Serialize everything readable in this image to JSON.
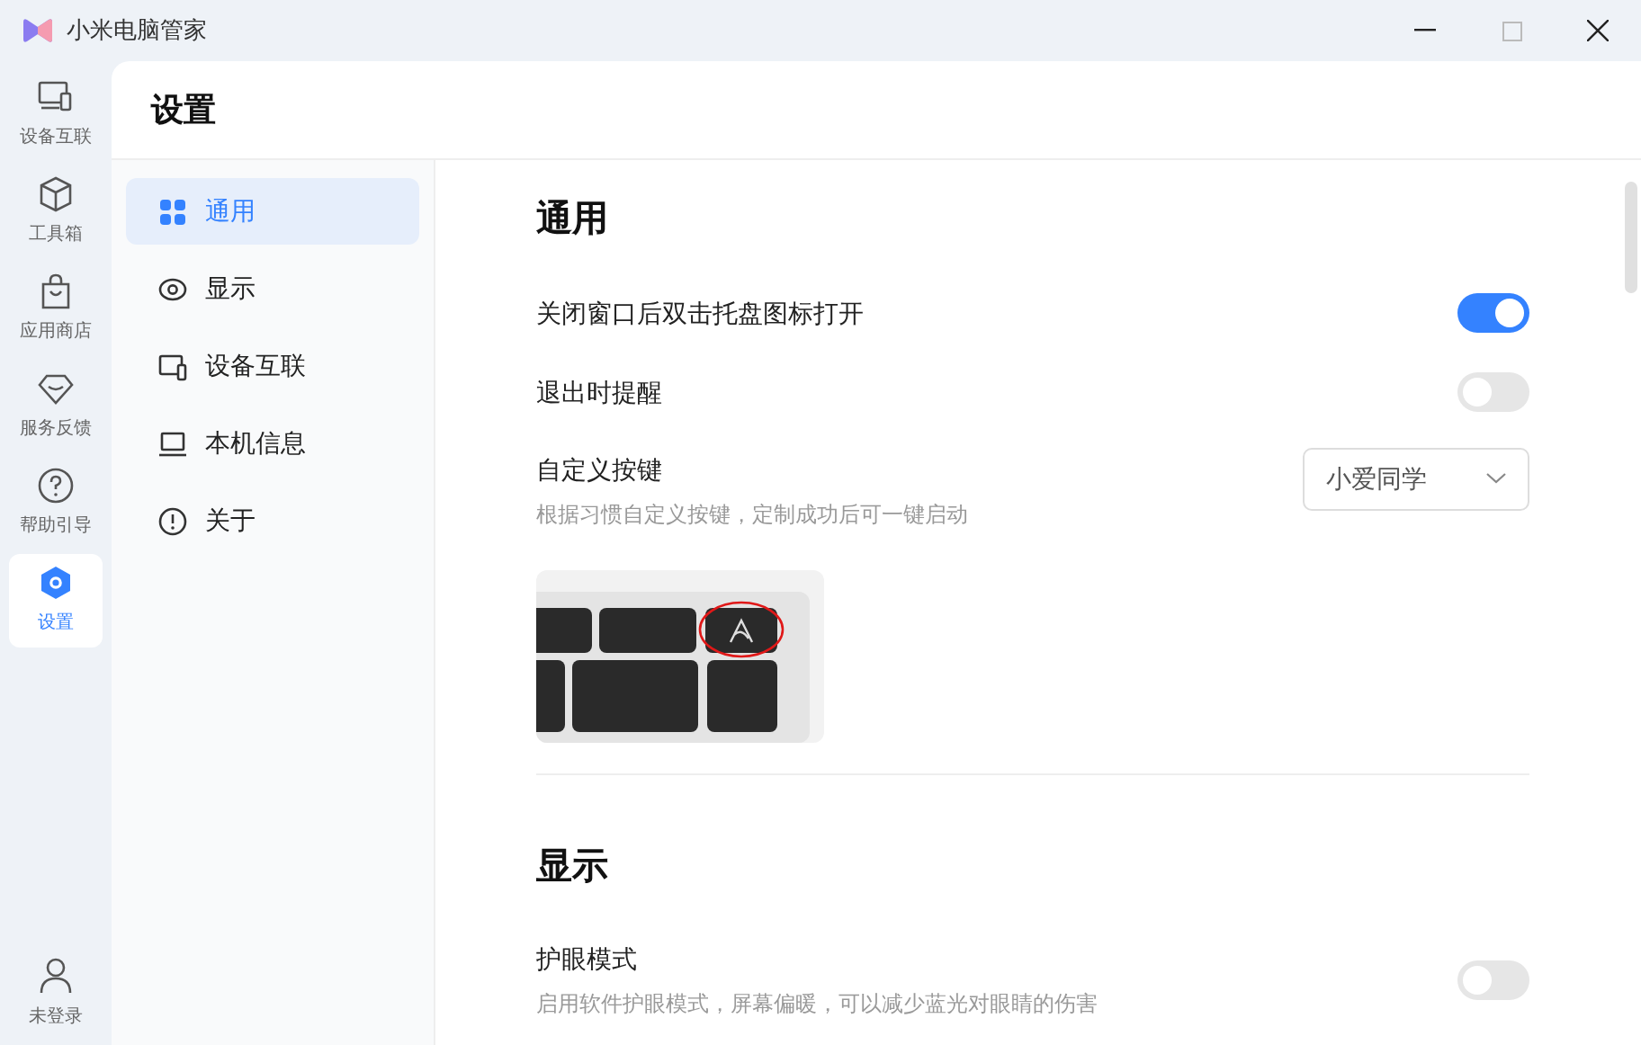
{
  "window": {
    "title": "小米电脑管家"
  },
  "rail": {
    "items": [
      {
        "label": "设备互联",
        "selected": false
      },
      {
        "label": "工具箱",
        "selected": false
      },
      {
        "label": "应用商店",
        "selected": false
      },
      {
        "label": "服务反馈",
        "selected": false
      },
      {
        "label": "帮助引导",
        "selected": false
      },
      {
        "label": "设置",
        "selected": true
      }
    ],
    "account": "未登录"
  },
  "page_title": "设置",
  "nav": [
    {
      "label": "通用",
      "selected": true
    },
    {
      "label": "显示",
      "selected": false
    },
    {
      "label": "设备互联",
      "selected": false
    },
    {
      "label": "本机信息",
      "selected": false
    },
    {
      "label": "关于",
      "selected": false
    }
  ],
  "sections": [
    {
      "title": "通用",
      "settings": [
        {
          "kind": "toggle",
          "label": "关闭窗口后双击托盘图标打开",
          "on": true
        },
        {
          "kind": "toggle",
          "label": "退出时提醒",
          "on": false
        },
        {
          "kind": "select",
          "label": "自定义按键",
          "description": "根据习惯自定义按键，定制成功后可一键启动",
          "value": "小爱同学"
        }
      ]
    },
    {
      "title": "显示",
      "settings": [
        {
          "kind": "toggle",
          "label": "护眼模式",
          "description": "启用软件护眼模式，屏幕偏暖，可以减少蓝光对眼睛的伤害",
          "on": false
        }
      ]
    }
  ]
}
